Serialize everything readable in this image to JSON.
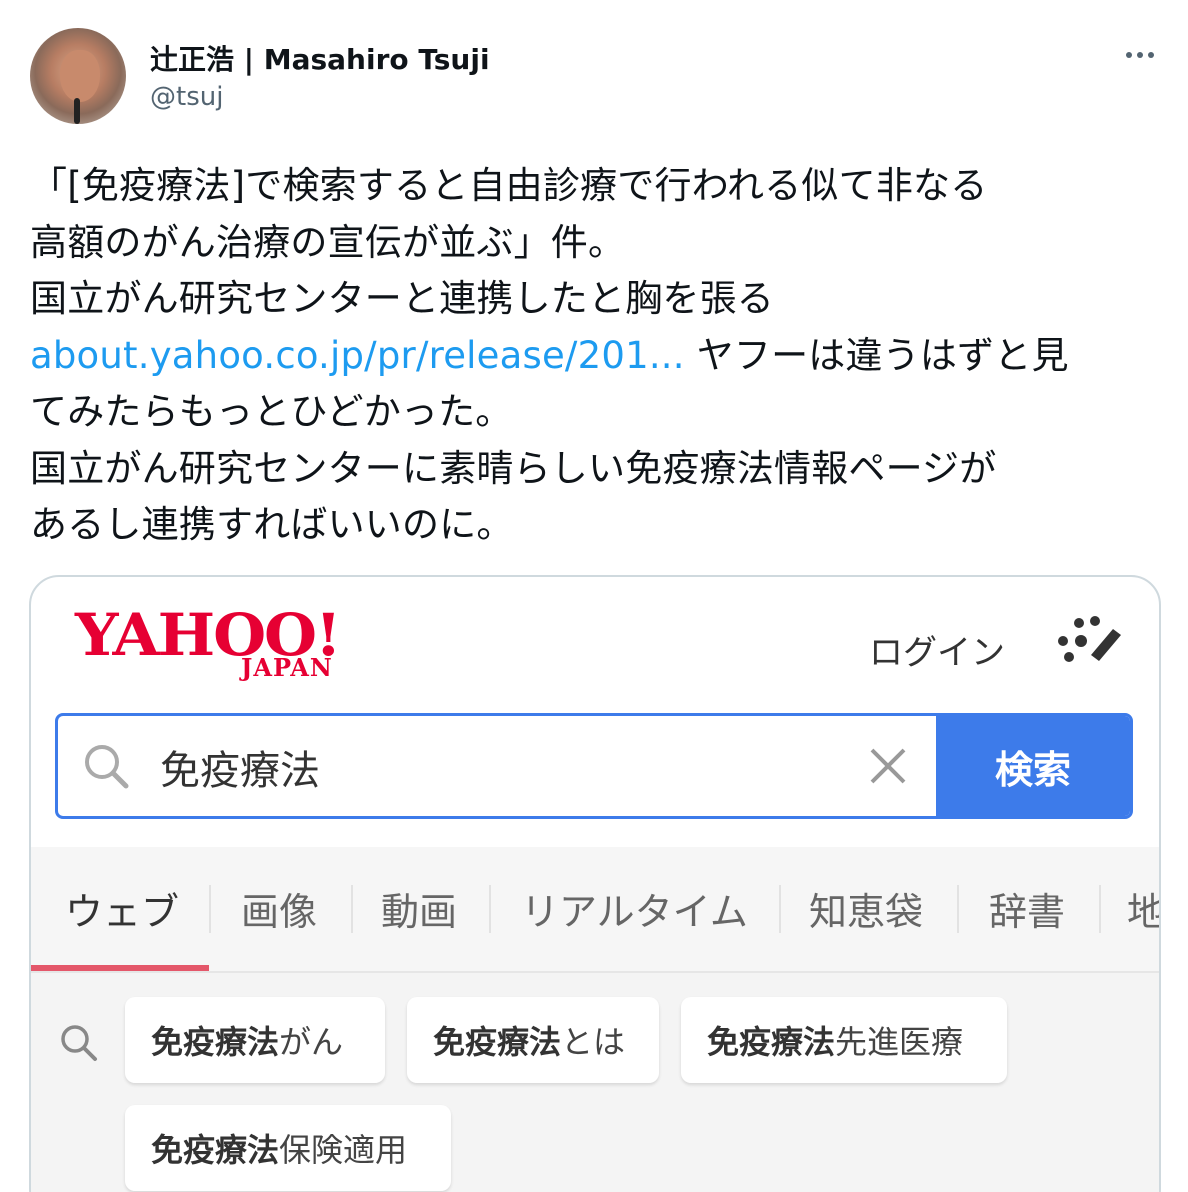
{
  "author": {
    "display_name": "辻正浩 | Masahiro Tsuji",
    "handle": "@tsuj"
  },
  "tweet": {
    "lines": [
      "「[免疫療法]で検索すると自由診療で行われる似て非なる",
      "高額のがん治療の宣伝が並ぶ」件。",
      "国立がん研究センターと連携したと胸を張る"
    ],
    "link_text": "about.yahoo.co.jp/pr/release/201...",
    "after_link": " ヤフーは違うはずと見",
    "lines_after": [
      "てみたらもっとひどかった。",
      "国立がん研究センターに素晴らしい免疫療法情報ページが",
      "あるし連携すればいいのに。"
    ]
  },
  "screenshot": {
    "logo_word": "YAHOO!",
    "logo_sub": "JAPAN",
    "login_label": "ログイン",
    "search_value": "免疫療法",
    "search_button": "検索",
    "tabs": [
      "ウェブ",
      "画像",
      "動画",
      "リアルタイム",
      "知恵袋",
      "辞書",
      "地"
    ],
    "suggestions": [
      {
        "bold": "免疫療法",
        "rest": " がん"
      },
      {
        "bold": "免疫療法",
        "rest": "とは"
      },
      {
        "bold": "免疫療法",
        "rest": " 先進医療"
      },
      {
        "bold": "免疫療法",
        "rest": " 保険適用"
      }
    ]
  },
  "colors": {
    "link": "#1d9bf0",
    "yahoo_red": "#e60033",
    "search_blue": "#3d7bea",
    "tab_underline": "#e4576a"
  }
}
